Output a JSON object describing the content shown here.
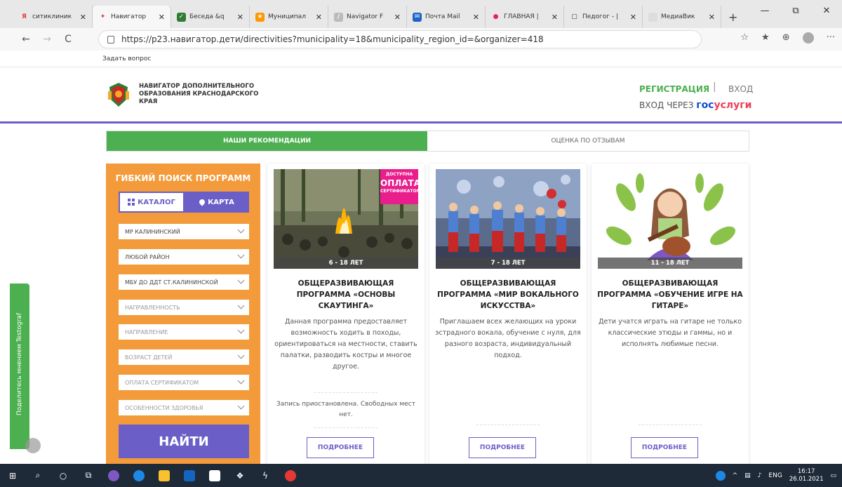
{
  "browser": {
    "tabs": [
      {
        "label": "ситиклиник",
        "icon_color": "#e53935",
        "icon_glyph": "Я"
      },
      {
        "label": "Навигатор",
        "icon_color": "#ffffff",
        "icon_glyph": "✦",
        "active": true
      },
      {
        "label": "Беседа &q",
        "icon_color": "#2e7d32",
        "icon_glyph": "✓"
      },
      {
        "label": "Муниципал",
        "icon_color": "#ff9800",
        "icon_glyph": "★"
      },
      {
        "label": "Navigator F",
        "icon_color": "#bbbbbb",
        "icon_glyph": "/"
      },
      {
        "label": "Почта Mail",
        "icon_color": "#1e63c6",
        "icon_glyph": "✉"
      },
      {
        "label": "ГЛАВНАЯ |",
        "icon_color": "#e91e63",
        "icon_glyph": "●"
      },
      {
        "label": "Педогог - |",
        "icon_color": "#ffffff",
        "icon_glyph": "▢"
      },
      {
        "label": "МедиаВик",
        "icon_color": "#dddddd",
        "icon_glyph": ""
      }
    ],
    "new_tab": "+",
    "url": "https://p23.навигатор.дети/directivities?municipality=18&municipality_region_id=&organizer=418",
    "nav_back": "←",
    "nav_forward": "→",
    "nav_reload": "C",
    "win_min": "—",
    "win_max": "⧉",
    "win_close": "✕"
  },
  "askbar": {
    "label": "Задать вопрос"
  },
  "site": {
    "brand": "НАВИГАТОР ДОПОЛНИТЕЛЬНОГО ОБРАЗОВАНИЯ КРАСНОДАРСКОГО КРАЯ",
    "register": "РЕГИСТРАЦИЯ",
    "separator": "|",
    "login": "ВХОД",
    "gosuslugi_prefix": "ВХОД ЧЕРЕЗ",
    "gosuslugi_1": "гос",
    "gosuslugi_2": "услуги"
  },
  "tabs": {
    "recommendations": "НАШИ РЕКОМЕНДАЦИИ",
    "reviews": "ОЦЕНКА ПО ОТЗЫВАМ"
  },
  "search": {
    "title": "ГИБКИЙ ПОИСК ПРОГРАММ",
    "catalog": "КАТАЛОГ",
    "map": "КАРТА",
    "filters": [
      {
        "label": "МР КАЛИНИНСКИЙ",
        "dim": false
      },
      {
        "label": "ЛЮБОЙ РАЙОН",
        "dim": false
      },
      {
        "label": "МБУ ДО ДДТ СТ.КАЛИНИНСКОЙ",
        "dim": false
      },
      {
        "label": "НАПРАВЛЕННОСТЬ",
        "dim": true
      },
      {
        "label": "НАПРАВЛЕНИЕ",
        "dim": true
      },
      {
        "label": "ВОЗРАСТ ДЕТЕЙ",
        "dim": true
      },
      {
        "label": "ОПЛАТА СЕРТИФИКАТОМ",
        "dim": true
      },
      {
        "label": "ОСОБЕННОСТИ ЗДОРОВЬЯ",
        "dim": true
      }
    ],
    "find": "НАЙТИ"
  },
  "cards": [
    {
      "age": "6 - 18 ЛЕТ",
      "title": "ОБЩЕРАЗВИВАЮЩАЯ ПРОГРАММА «ОСНОВЫ СКАУТИНГА»",
      "desc": "Данная программа предоставляет возможность ходить в походы, ориентироваться на местности, ставить палатки, разводить костры и многое другое.",
      "status": "Запись приостановлена. Свободных мест нет.",
      "more": "ПОДРОБНЕЕ",
      "badge_top": "ДОСТУПНА",
      "badge_big": "ОПЛАТА",
      "badge_bottom": "СЕРТИФИКАТОМ"
    },
    {
      "age": "7 - 18 ЛЕТ",
      "title": "ОБЩЕРАЗВИВАЮЩАЯ ПРОГРАММА «МИР ВОКАЛЬНОГО ИСКУССТВА»",
      "desc": "Приглашаем всех желающих на уроки эстрадного вокала, обучение с нуля, для разного возраста, индивидуальный подход.",
      "more": "ПОДРОБНЕЕ"
    },
    {
      "age": "11 - 18 ЛЕТ",
      "title": "ОБЩЕРАЗВИВАЮЩАЯ ПРОГРАММА «ОБУЧЕНИЕ ИГРЕ НА ГИТАРЕ»",
      "desc": "Дети учатся играть на гитаре не только классические этюды и гаммы, но и исполнять любимые песни.",
      "more": "ПОДРОБНЕЕ"
    }
  ],
  "testograf": {
    "label": "Поделитесь мнением  Testograf"
  },
  "taskbar": {
    "lang": "ENG",
    "time": "16:17",
    "date": "26.01.2021"
  },
  "colors": {
    "orange": "#f39a3b",
    "purple": "#6b5fc7",
    "green": "#4caf50",
    "pink": "#e91e8c"
  }
}
